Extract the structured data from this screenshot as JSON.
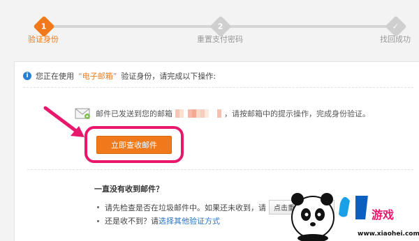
{
  "steps": [
    {
      "num": "1",
      "label": "验证身份",
      "active": true
    },
    {
      "num": "2",
      "label": "重置支付密码",
      "active": false
    },
    {
      "num": "✓",
      "label": "找回成功",
      "active": false
    }
  ],
  "info": {
    "prefix": "您正在使用",
    "method": "“电子邮箱”",
    "suffix": "验证身份，请完成以下操作:"
  },
  "mail": {
    "sent_text": "邮件已发送到您的邮箱",
    "after_text": "，请按邮箱中的提示操作，完成身份验证。"
  },
  "button": {
    "label": "立即查收邮件"
  },
  "help": {
    "title": "一直没有收到邮件？",
    "item1_text": "请先检查是否在垃圾邮件中。如果还未收到，请",
    "resend_label": "点击重新发送邮件",
    "item2_prefix": "还是收不到？请",
    "item2_link": "选择其他验证方式"
  },
  "watermark": {
    "brand": "小黑游戏",
    "url": "www.xiaohei.com"
  },
  "colors": {
    "accent": "#f07a1b",
    "highlight_border": "#e8176c",
    "link": "#2b73c0"
  }
}
